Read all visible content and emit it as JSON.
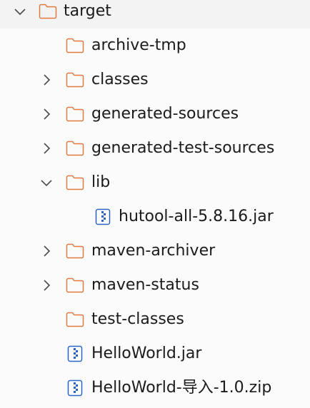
{
  "tree": {
    "items": [
      {
        "label": "target",
        "type": "folder",
        "level": 0,
        "chevron": "expanded"
      },
      {
        "label": "archive-tmp",
        "type": "folder",
        "level": 1,
        "chevron": "none"
      },
      {
        "label": "classes",
        "type": "folder",
        "level": 1,
        "chevron": "collapsed"
      },
      {
        "label": "generated-sources",
        "type": "folder",
        "level": 1,
        "chevron": "collapsed"
      },
      {
        "label": "generated-test-sources",
        "type": "folder",
        "level": 1,
        "chevron": "collapsed"
      },
      {
        "label": "lib",
        "type": "folder",
        "level": 1,
        "chevron": "expanded"
      },
      {
        "label": "hutool-all-5.8.16.jar",
        "type": "archive",
        "level": 2,
        "chevron": "none"
      },
      {
        "label": "maven-archiver",
        "type": "folder",
        "level": 1,
        "chevron": "collapsed"
      },
      {
        "label": "maven-status",
        "type": "folder",
        "level": 1,
        "chevron": "collapsed"
      },
      {
        "label": "test-classes",
        "type": "folder",
        "level": 1,
        "chevron": "none"
      },
      {
        "label": "HelloWorld.jar",
        "type": "archive",
        "level": 1,
        "chevron": "none"
      },
      {
        "label": "HelloWorld-导入-1.0.zip",
        "type": "archive",
        "level": 1,
        "chevron": "none"
      }
    ]
  },
  "colors": {
    "folder_stroke": "#e07a3f",
    "archive_stroke": "#2b62c9",
    "chevron": "#4a4a4a",
    "text": "#1b1b1b"
  }
}
